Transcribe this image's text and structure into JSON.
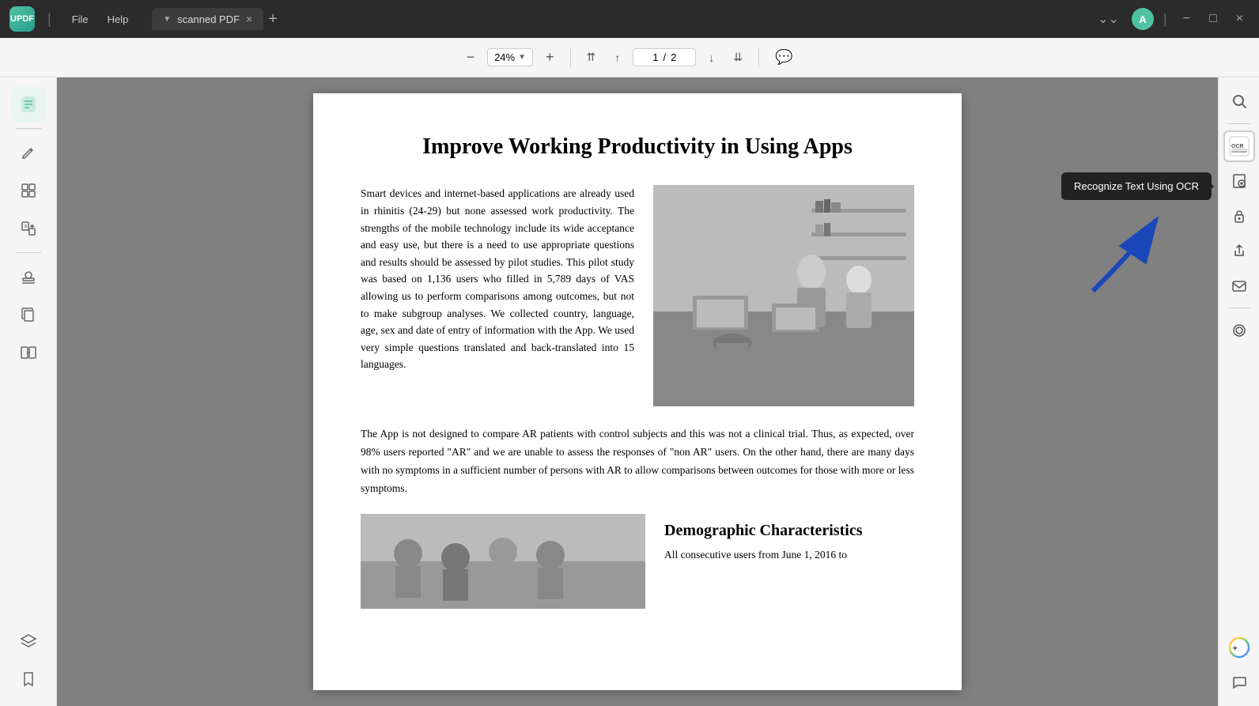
{
  "app": {
    "logo": "UPDF",
    "tab_name": "scanned PDF",
    "menu_items": [
      "File",
      "Help"
    ]
  },
  "titlebar": {
    "avatar_initial": "A",
    "minimize": "−",
    "maximize": "□",
    "close": "×"
  },
  "toolbar": {
    "zoom_out": "−",
    "zoom_level": "24%",
    "zoom_in": "+",
    "go_first": "⇈",
    "go_prev": "↑",
    "page_current": "1",
    "page_separator": "/",
    "page_total": "2",
    "go_next": "↓",
    "go_last": "⇊",
    "comment": "💬"
  },
  "left_sidebar": {
    "icons": [
      {
        "name": "reader-mode",
        "symbol": "📄",
        "active": true
      },
      {
        "name": "edit-pdf",
        "symbol": "✏️",
        "active": false
      },
      {
        "name": "organize",
        "symbol": "📑",
        "active": false
      },
      {
        "name": "convert",
        "symbol": "📋",
        "active": false
      },
      {
        "name": "stamp",
        "symbol": "🖨️",
        "active": false
      },
      {
        "name": "duplicate",
        "symbol": "⧉",
        "active": false
      },
      {
        "name": "compare",
        "symbol": "⊞",
        "active": false
      }
    ],
    "bottom_icons": [
      {
        "name": "layers",
        "symbol": "◫"
      },
      {
        "name": "bookmark",
        "symbol": "🔖"
      }
    ]
  },
  "pdf": {
    "title": "Improve Working Productivity\nin Using Apps",
    "para1": "Smart devices and internet-based applications are already used in rhinitis (24-29) but none assessed work productivity. The strengths of the mobile technology include its wide acceptance and easy use, but there is a need to use appropriate questions and results should be assessed by pilot studies. This pilot study was based on 1,136 users who filled in 5,789 days of VAS allowing us to perform comparisons among outcomes, but not to make subgroup analyses. We collected country, language, age, sex and date of entry of information with the App. We used very simple questions translated and back-translated into 15 languages.",
    "para2": "The App is not designed to compare AR patients with control subjects and this was not a clinical trial. Thus, as expected, over 98% users reported \"AR\" and we are unable to assess the responses of \"non AR\" users. On the other hand, there are many days with no symptoms in a sufficient number of persons with AR to allow comparisons between outcomes for those with more or less symptoms.",
    "section_title": "Demographic Characteristics",
    "para3": "All consecutive users from June 1, 2016 to"
  },
  "right_sidebar": {
    "icons": [
      {
        "name": "search",
        "symbol": "🔍"
      },
      {
        "name": "ocr",
        "symbol": "OCR"
      },
      {
        "name": "export",
        "symbol": "↑"
      },
      {
        "name": "protect",
        "symbol": "🔒"
      },
      {
        "name": "share",
        "symbol": "⬆"
      },
      {
        "name": "email",
        "symbol": "✉"
      },
      {
        "name": "stamps",
        "symbol": "⊙"
      }
    ],
    "bottom_icons": [
      {
        "name": "ai",
        "symbol": "✦"
      },
      {
        "name": "chat",
        "symbol": "💬"
      }
    ]
  },
  "ocr_tooltip": {
    "text": "Recognize Text Using OCR"
  }
}
